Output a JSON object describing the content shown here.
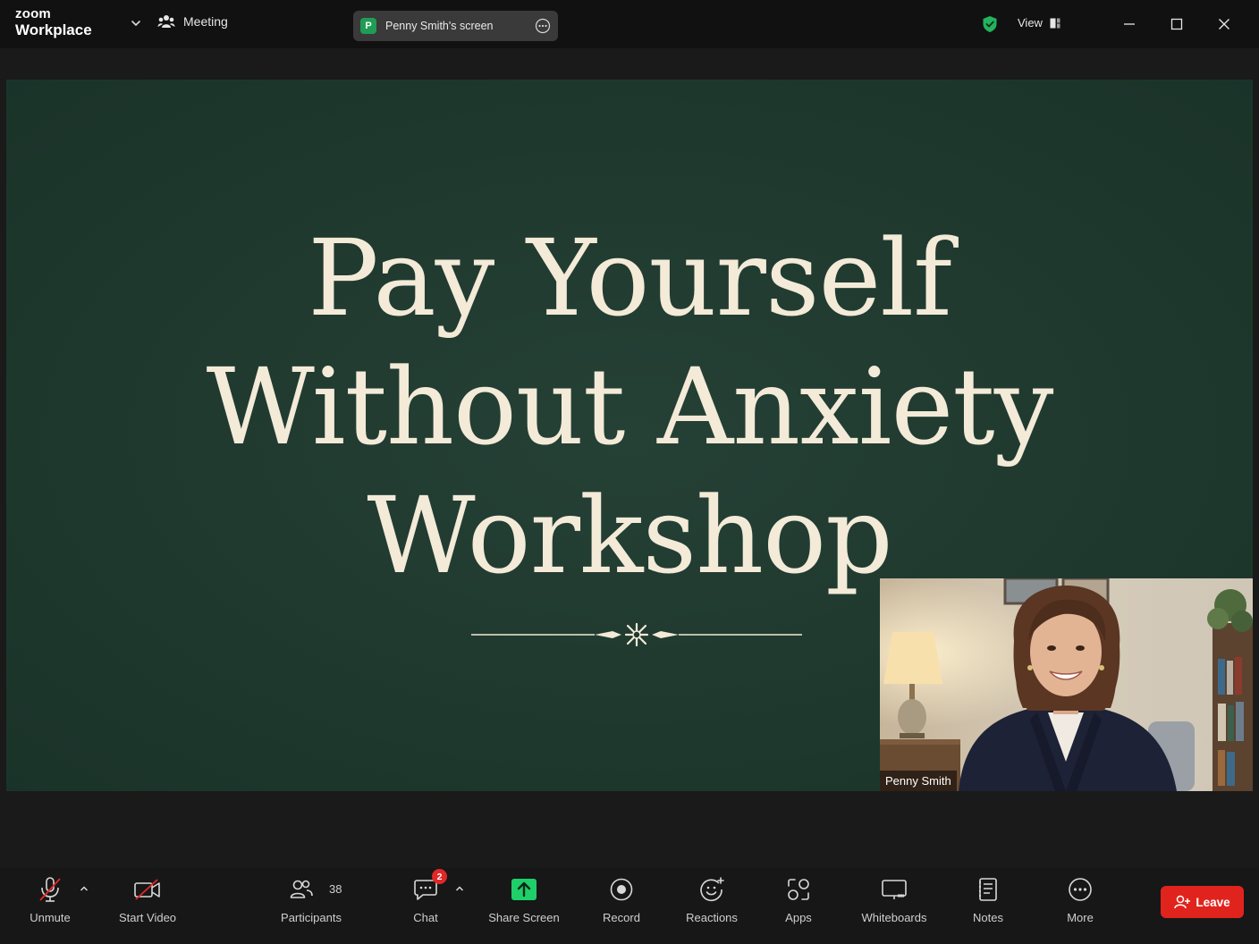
{
  "app": {
    "brand_top": "zoom",
    "brand_bottom": "Workplace"
  },
  "header": {
    "meeting_label": "Meeting",
    "share_badge_letter": "P",
    "share_label": "Penny Smith's screen",
    "view_label": "View"
  },
  "slide": {
    "title_lines": [
      "Pay Yourself",
      "Without Anxiety",
      "Workshop"
    ]
  },
  "video": {
    "name": "Penny Smith"
  },
  "toolbar": {
    "unmute": "Unmute",
    "start_video": "Start Video",
    "participants": "Participants",
    "participants_count": "38",
    "chat": "Chat",
    "chat_badge": "2",
    "share_screen": "Share Screen",
    "record": "Record",
    "reactions": "Reactions",
    "apps": "Apps",
    "whiteboards": "Whiteboards",
    "notes": "Notes",
    "more": "More",
    "leave": "Leave"
  },
  "colors": {
    "stage_bg": "#1e3a2f",
    "slide_text": "#f3ead8",
    "share_green": "#1fcf6a",
    "leave_red": "#e0241d",
    "badge_red": "#e02828",
    "shield_green": "#22b35e"
  }
}
